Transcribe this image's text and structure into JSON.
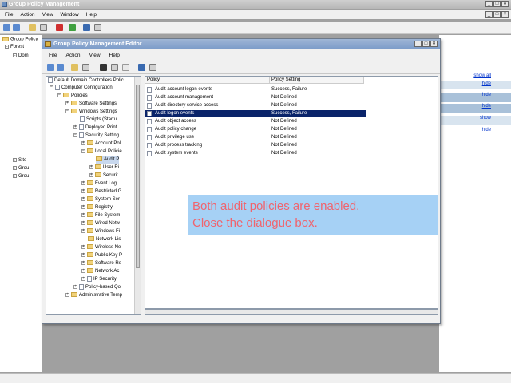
{
  "outer": {
    "title": "Group Policy Management",
    "menu": [
      "File",
      "Action",
      "View",
      "Window",
      "Help"
    ],
    "tree": [
      "Group Policy",
      "Forest",
      "Dom",
      "Site",
      "Grou",
      "Grou"
    ],
    "right_links": [
      "show all",
      "hide",
      "hide",
      "hide",
      "show",
      "hide"
    ]
  },
  "editor": {
    "title": "Group Policy Management Editor",
    "menu": [
      "File",
      "Action",
      "View",
      "Help"
    ],
    "tree": [
      "Default Domain Controllers Polic",
      "Computer Configuration",
      "Policies",
      "Software Settings",
      "Windows Settings",
      "Scripts (Startu",
      "Deployed Print",
      "Security Setting",
      "Account Poli",
      "Local Policie",
      "Audit P",
      "User Ri",
      "Securit",
      "Event Log",
      "Restricted G",
      "System Ser",
      "Registry",
      "File System",
      "Wired Netw",
      "Windows Fi",
      "Network Lis",
      "Wireless Ne",
      "Public Key P",
      "Software Re",
      "Network Ac",
      "IP Security",
      "Policy-based Qo",
      "Administrative Temp"
    ],
    "columns": [
      "Policy",
      "Policy Setting"
    ],
    "policies": [
      {
        "name": "Audit account logon events",
        "setting": "Success, Failure"
      },
      {
        "name": "Audit account management",
        "setting": "Not Defined"
      },
      {
        "name": "Audit directory service access",
        "setting": "Not Defined"
      },
      {
        "name": "Audit logon events",
        "setting": "Success, Failure"
      },
      {
        "name": "Audit object access",
        "setting": "Not Defined"
      },
      {
        "name": "Audit policy change",
        "setting": "Not Defined"
      },
      {
        "name": "Audit privilege use",
        "setting": "Not Defined"
      },
      {
        "name": "Audit process tracking",
        "setting": "Not Defined"
      },
      {
        "name": "Audit system events",
        "setting": "Not Defined"
      }
    ]
  },
  "overlay": {
    "line1": "Both audit policies are enabled.",
    "line2": "Close the dialogue box."
  },
  "colors": {
    "selected_row": "#0a246a",
    "overlay_bg": "#a6d1f5",
    "overlay_text": "#f0646e"
  }
}
